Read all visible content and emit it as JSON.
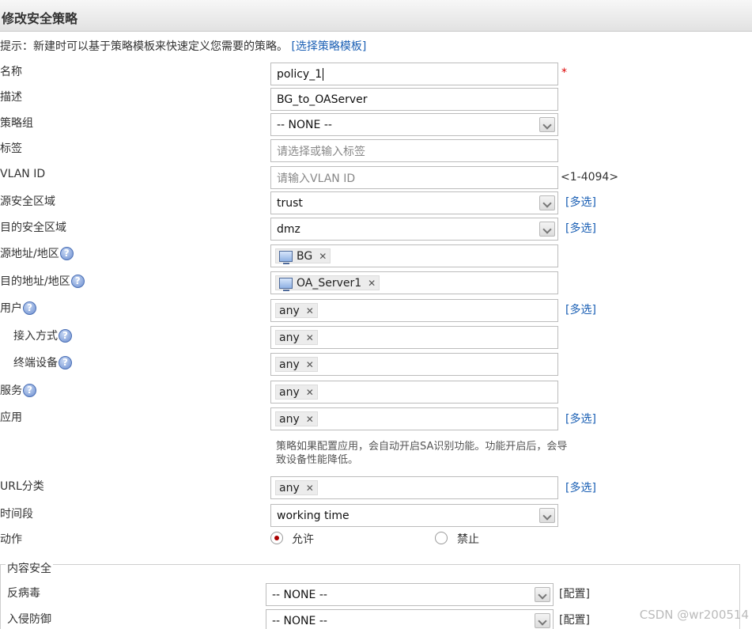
{
  "header": {
    "title": "修改安全策略"
  },
  "hint": {
    "text": "提示：新建时可以基于策略模板来快速定义您需要的策略。",
    "link": "[选择策略模板]"
  },
  "form": {
    "name": {
      "label": "名称",
      "value": "policy_1",
      "required": "*"
    },
    "desc": {
      "label": "描述",
      "value": "BG_to_OAServer"
    },
    "group": {
      "label": "策略组",
      "value": "-- NONE --"
    },
    "tag": {
      "label": "标签",
      "placeholder": "请选择或输入标签"
    },
    "vlan": {
      "label": "VLAN ID",
      "placeholder": "请输入VLAN ID",
      "range": "<1-4094>"
    },
    "src_zone": {
      "label": "源安全区域",
      "value": "trust",
      "multi": "[多选]"
    },
    "dst_zone": {
      "label": "目的安全区域",
      "value": "dmz",
      "multi": "[多选]"
    },
    "src_addr": {
      "label": "源地址/地区",
      "tag": "BG"
    },
    "dst_addr": {
      "label": "目的地址/地区",
      "tag": "OA_Server1"
    },
    "user": {
      "label": "用户",
      "tag": "any",
      "multi": "[多选]"
    },
    "access": {
      "label": "接入方式",
      "tag": "any"
    },
    "terminal": {
      "label": "终端设备",
      "tag": "any"
    },
    "service": {
      "label": "服务",
      "tag": "any"
    },
    "app": {
      "label": "应用",
      "tag": "any",
      "multi": "[多选]",
      "note": "策略如果配置应用，会自动开启SA识别功能。功能开启后，会导致设备性能降低。"
    },
    "url": {
      "label": "URL分类",
      "tag": "any",
      "multi": "[多选]"
    },
    "schedule": {
      "label": "时间段",
      "value": "working time"
    },
    "action": {
      "label": "动作",
      "allow": "允许",
      "deny": "禁止",
      "selected": "allow"
    }
  },
  "content_security": {
    "legend": "内容安全",
    "antivirus": {
      "label": "反病毒",
      "value": "-- NONE --",
      "config": "[配置]"
    },
    "ips": {
      "label": "入侵防御",
      "value": "-- NONE --",
      "config": "[配置]"
    }
  },
  "icons": {
    "help": "?",
    "remove": "✕"
  },
  "watermark": "CSDN @wr200514",
  "colors": {
    "link": "#1a5fb4",
    "required": "#dd0000",
    "radio_selected": "#aa0000"
  }
}
